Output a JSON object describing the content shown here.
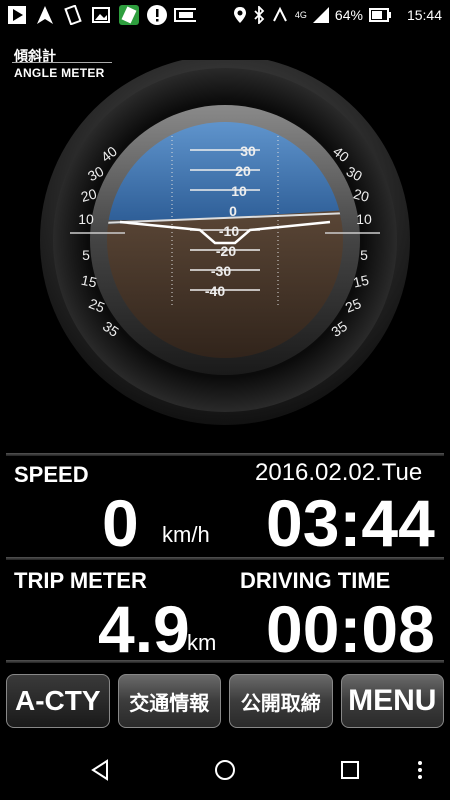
{
  "statusbar": {
    "battery": "64%",
    "time": "15:44",
    "network": "4G",
    "icons": [
      "play-icon",
      "navigation-icon",
      "vibrate-icon",
      "image-icon",
      "app-icon",
      "alert-icon",
      "tablet-icon",
      "location-icon",
      "bluetooth-icon",
      "nfc-icon",
      "signal-icon",
      "battery-icon"
    ]
  },
  "header": {
    "title_jp": "傾斜計",
    "title_en": "ANGLE METER"
  },
  "gauge": {
    "left_scale": [
      "40",
      "30",
      "20",
      "10",
      "5",
      "15",
      "25",
      "35"
    ],
    "right_scale": [
      "40",
      "30",
      "20",
      "10",
      "5",
      "15",
      "25",
      "35"
    ],
    "pitch_scale": [
      "30",
      "20",
      "10",
      "0",
      "-10",
      "-20",
      "-30",
      "-40"
    ],
    "colors": {
      "sky": "#3b6fa8",
      "ground": "#4a3a2e"
    }
  },
  "speed": {
    "label": "SPEED",
    "value": "0",
    "unit": "km/h"
  },
  "date": "2016.02.02.Tue",
  "clock": "03:44",
  "trip": {
    "label": "TRIP METER",
    "value": "4.9",
    "unit": "km"
  },
  "driving": {
    "label": "DRIVING TIME",
    "value": "00:08"
  },
  "buttons": {
    "acty": "A-CTY",
    "traffic": "交通情報",
    "enforcement": "公開取締",
    "menu": "MENU"
  }
}
